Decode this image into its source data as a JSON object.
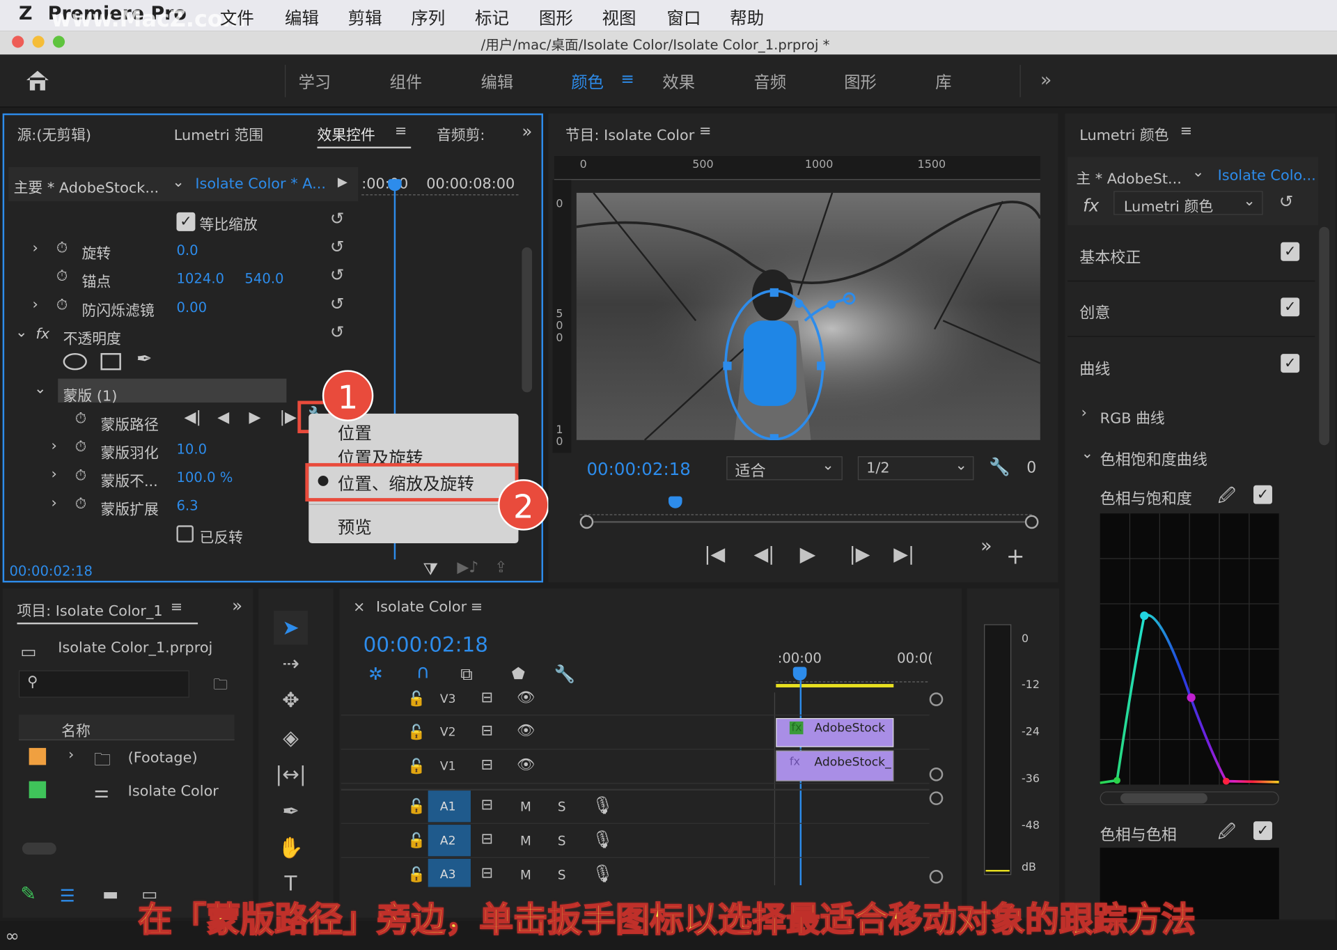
{
  "app": {
    "name": "Premiere Pro",
    "watermark": "www.MacZ.com"
  },
  "menu": [
    "文件",
    "编辑",
    "剪辑",
    "序列",
    "标记",
    "图形",
    "视图",
    "窗口",
    "帮助"
  ],
  "window_title": "/用户/mac/桌面/Isolate Color/Isolate Color_1.prproj *",
  "workspaces": [
    "学习",
    "组件",
    "编辑",
    "颜色",
    "效果",
    "音频",
    "图形",
    "库"
  ],
  "active_workspace": "颜色",
  "source_panel": {
    "tabs": [
      "源:(无剪辑)",
      "Lumetri 范围",
      "效果控件",
      "音频剪:"
    ],
    "master": "主要 * AdobeStock...",
    "clip": "Isolate Color * A...",
    "time_start": ":00:00",
    "time_end": "00:00:08:00",
    "rows": {
      "uniform_scale": "等比缩放",
      "rotation": "旋转",
      "rotation_val": "0.0",
      "anchor": "锚点",
      "anchor_x": "1024.0",
      "anchor_y": "540.0",
      "flicker": "防闪烁滤镜",
      "flicker_val": "0.00",
      "opacity": "不透明度",
      "mask": "蒙版 (1)",
      "mask_path": "蒙版路径",
      "feather": "蒙版羽化",
      "feather_val": "10.0",
      "mask_opacity": "蒙版不...",
      "mask_opacity_val": "100.0 %",
      "expansion": "蒙版扩展",
      "expansion_val": "6.3",
      "inverted": "已反转"
    },
    "timecode": "00:00:02:18"
  },
  "context_menu": [
    "位置",
    "位置及旋转",
    "位置、缩放及旋转",
    "预览"
  ],
  "badges": [
    "1",
    "2"
  ],
  "program": {
    "title": "节目: Isolate Color",
    "ruler": [
      "0",
      "500",
      "1000",
      "1500"
    ],
    "vruler": [
      "0",
      "5 0 0",
      "1 0"
    ],
    "timecode": "00:00:02:18",
    "fit": "适合",
    "res": "1/2"
  },
  "lumetri": {
    "title": "Lumetri 颜色",
    "master": "主 * AdobeSt...",
    "clip": "Isolate Colo...",
    "effect": "Lumetri 颜色",
    "sections": [
      "基本校正",
      "创意",
      "曲线"
    ],
    "rgb_curves": "RGB 曲线",
    "hsl_curves": "色相饱和度曲线",
    "hue_sat": "色相与饱和度",
    "hue_hue": "色相与色相"
  },
  "project": {
    "title": "项目: Isolate Color_1",
    "file": "Isolate Color_1.prproj",
    "col_name": "名称",
    "items": [
      "(Footage)",
      "Isolate Color"
    ]
  },
  "timeline": {
    "title": "Isolate Color",
    "timecode": "00:00:02:18",
    "ruler": [
      ":00:00",
      "00:0("
    ],
    "tracks": [
      "V3",
      "V2",
      "V1",
      "A1",
      "A2",
      "A3"
    ],
    "m": "M",
    "s": "S",
    "clips": [
      "AdobeStock",
      "AdobeStock_"
    ]
  },
  "meter": {
    "labels": [
      "0",
      "-12",
      "-24",
      "-36",
      "-48",
      "dB"
    ]
  },
  "caption": "在「蒙版路径」旁边，单击扳手图标以选择最适合移动对象的跟踪方法",
  "colors": {
    "accent": "#2d8ceb",
    "badge": "#e94b3c",
    "clip": "#a98ee6"
  }
}
